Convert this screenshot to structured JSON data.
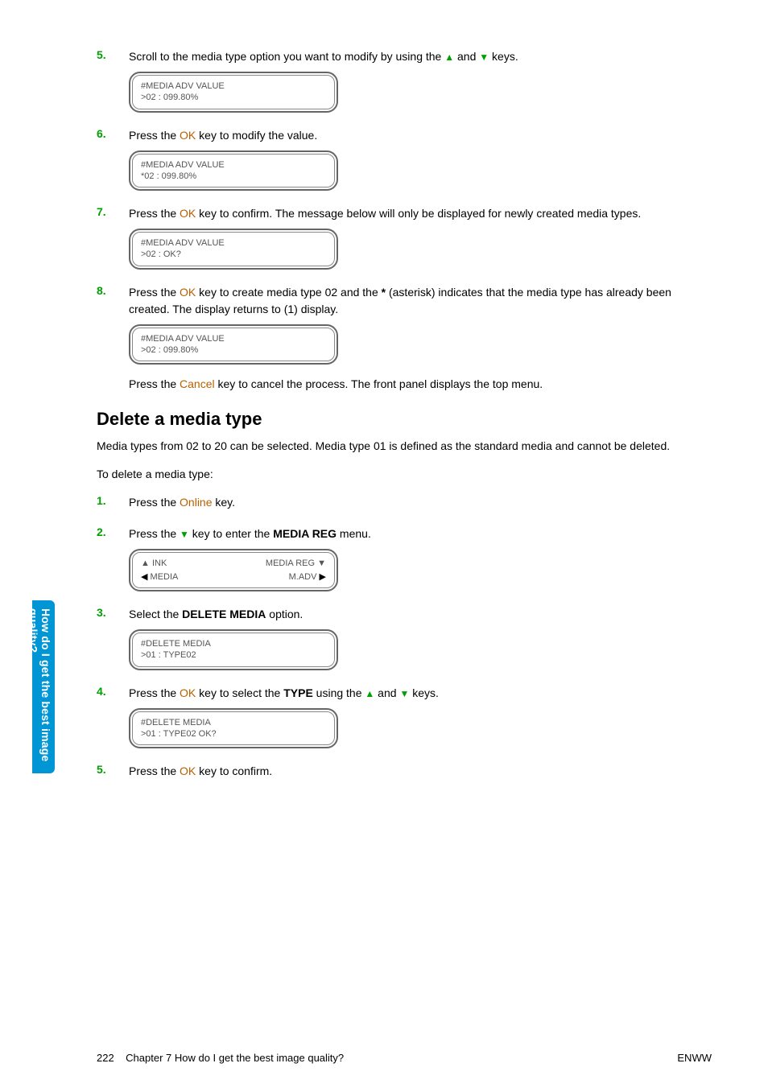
{
  "sidebar": {
    "line1": "How do I get the best image",
    "line2": "quality?"
  },
  "steps_a": [
    {
      "num": "5.",
      "prefix": "Scroll to the media type option you want to modify by using the ",
      "mid": " and ",
      "suffix": " keys.",
      "lcd": {
        "l1": "#MEDIA ADV VALUE",
        "l2": ">02 : 099.80%"
      }
    },
    {
      "num": "6.",
      "prefix": "Press the ",
      "key": "OK",
      "suffix": " key to modify the value.",
      "lcd": {
        "l1": "#MEDIA ADV VALUE",
        "l2": "*02 : 099.80%"
      }
    },
    {
      "num": "7.",
      "prefix": "Press the ",
      "key": "OK",
      "suffix": " key to confirm. The message below will only be displayed for newly created media types.",
      "lcd": {
        "l1": "#MEDIA ADV VALUE",
        "l2": ">02 : OK?"
      }
    },
    {
      "num": "8.",
      "prefix": "Press the ",
      "key": "OK",
      "mid1": " key to create media type 02 and the ",
      "asterisk": "*",
      "mid2": " (asterisk) indicates that the media type has already been created. The display returns to (1) display.",
      "lcd": {
        "l1": "#MEDIA ADV VALUE",
        "l2": ">02 : 099.80%"
      },
      "note_pre": "Press the ",
      "note_key": "Cancel",
      "note_post": " key to cancel the process. The front panel displays the top menu."
    }
  ],
  "section_title": "Delete a media type",
  "section_intro": "Media types from 02 to 20 can be selected. Media type 01 is defined as the standard media and cannot be deleted.",
  "section_lead": "To delete a media type:",
  "steps_b": [
    {
      "num": "1.",
      "prefix": "Press the ",
      "key": "Online",
      "suffix": " key."
    },
    {
      "num": "2.",
      "prefix": "Press the ",
      "mid": " key to enter the ",
      "bold": "MEDIA REG",
      "suffix": " menu.",
      "lcd_split": {
        "left1": "INK",
        "left2": "MEDIA",
        "right1": "MEDIA REG",
        "right2": "M.ADV"
      }
    },
    {
      "num": "3.",
      "prefix": "Select the ",
      "bold": "DELETE MEDIA",
      "suffix": " option.",
      "lcd": {
        "l1": "#DELETE MEDIA",
        "l2": ">01 : TYPE02"
      }
    },
    {
      "num": "4.",
      "prefix": "Press the ",
      "key": "OK",
      "mid1": " key to select the ",
      "bold": "TYPE",
      "mid2": " using the ",
      "mid3": " and ",
      "suffix": " keys.",
      "lcd": {
        "l1": "#DELETE MEDIA",
        "l2": ">01 : TYPE02 OK?"
      }
    },
    {
      "num": "5.",
      "prefix": "Press the ",
      "key": "OK",
      "suffix": " key to confirm."
    }
  ],
  "footer": {
    "page": "222",
    "chapter": "Chapter 7   How do I get the best image quality?",
    "brand": "ENWW"
  }
}
